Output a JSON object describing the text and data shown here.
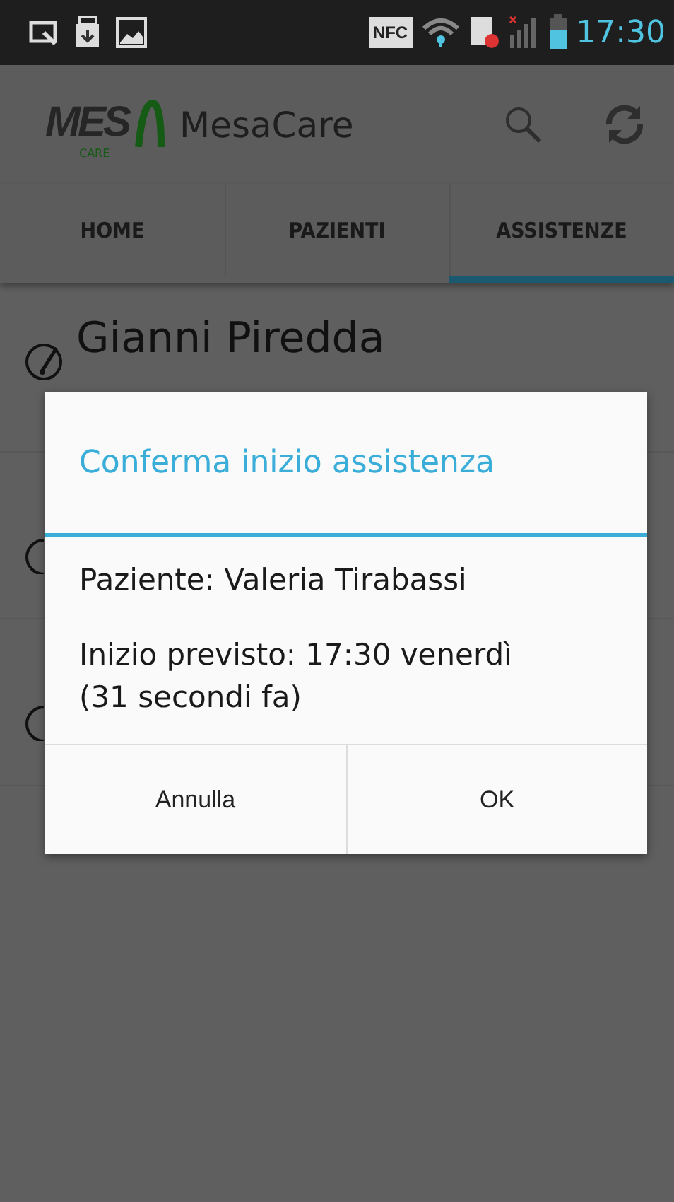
{
  "status_bar": {
    "nfc": "NFC",
    "time": "17:30"
  },
  "app_bar": {
    "logo_text": "MES",
    "logo_subtext": "CARE",
    "title": "MesaCare"
  },
  "tabs": [
    {
      "label": "HOME",
      "selected": false
    },
    {
      "label": "PAZIENTI",
      "selected": false
    },
    {
      "label": "ASSISTENZE",
      "selected": true
    }
  ],
  "list": {
    "rows": [
      {
        "title": "Gianni Piredda"
      },
      {
        "title": ""
      },
      {
        "title": ""
      }
    ]
  },
  "dialog": {
    "title": "Conferma inizio assistenza",
    "lines": [
      "Paziente: Valeria Tirabassi",
      "Inizio previsto: 17:30 venerdì (31 secondi fa)"
    ],
    "buttons": [
      "Annulla",
      "OK"
    ]
  }
}
